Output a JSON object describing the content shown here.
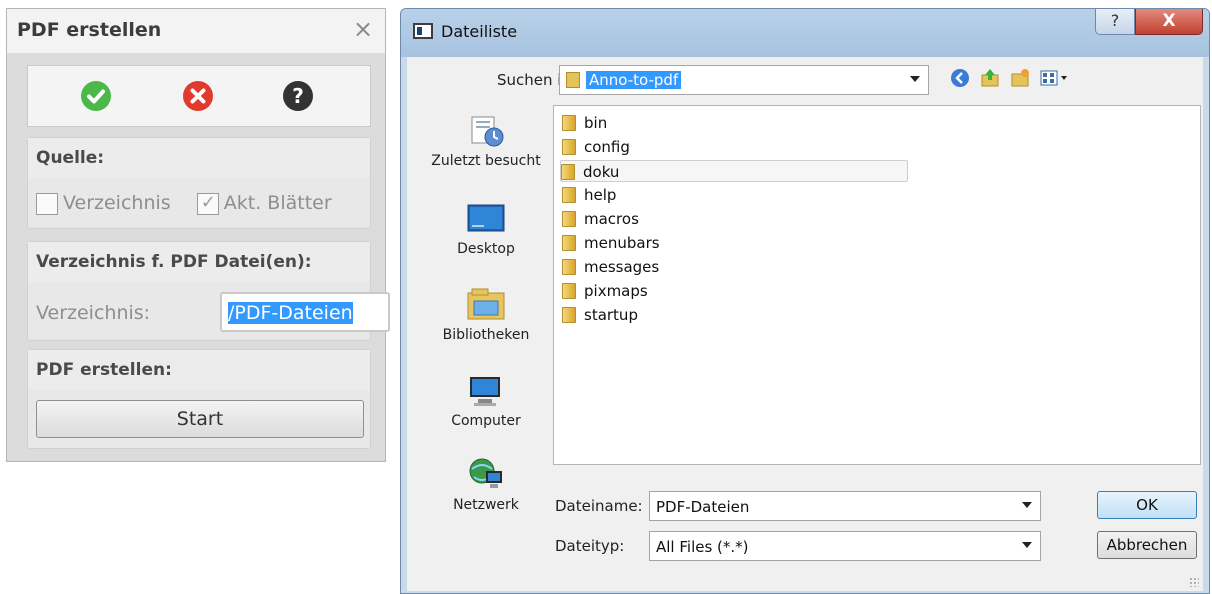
{
  "panel": {
    "title": "PDF erstellen",
    "close_glyph": "×",
    "tools": [
      {
        "name": "ok-check-icon",
        "color": "#4cb847"
      },
      {
        "name": "cancel-x-icon",
        "color": "#e0392e"
      },
      {
        "name": "help-question-icon",
        "color": "#333333"
      }
    ],
    "source": {
      "heading": "Quelle:",
      "directory_label": "Verzeichnis",
      "directory_checked": false,
      "sheets_label": "Akt. Blätter",
      "sheets_checked": true
    },
    "target": {
      "heading": "Verzeichnis f. PDF Datei(en):",
      "label": "Verzeichnis:",
      "value": "/PDF-Dateien"
    },
    "create": {
      "heading": "PDF erstellen:",
      "button": "Start"
    }
  },
  "dialog": {
    "title": "Dateiliste",
    "help_glyph": "?",
    "close_glyph": "X",
    "look_in_label": "Suchen in:",
    "look_in_value": "Anno-to-pdf",
    "places": [
      {
        "label": "Zuletzt besucht",
        "icon": "recent-places-icon"
      },
      {
        "label": "Desktop",
        "icon": "desktop-icon"
      },
      {
        "label": "Bibliotheken",
        "icon": "libraries-icon"
      },
      {
        "label": "Computer",
        "icon": "computer-icon"
      },
      {
        "label": "Netzwerk",
        "icon": "network-icon"
      }
    ],
    "files": [
      "bin",
      "config",
      "doku",
      "help",
      "macros",
      "menubars",
      "messages",
      "pixmaps",
      "startup"
    ],
    "hovered_file": "doku",
    "filename_label": "Dateiname:",
    "filename_value": "PDF-Dateien",
    "filetype_label": "Dateityp:",
    "filetype_value": "All Files (*.*)",
    "ok_button": "OK",
    "cancel_button": "Abbrechen"
  }
}
